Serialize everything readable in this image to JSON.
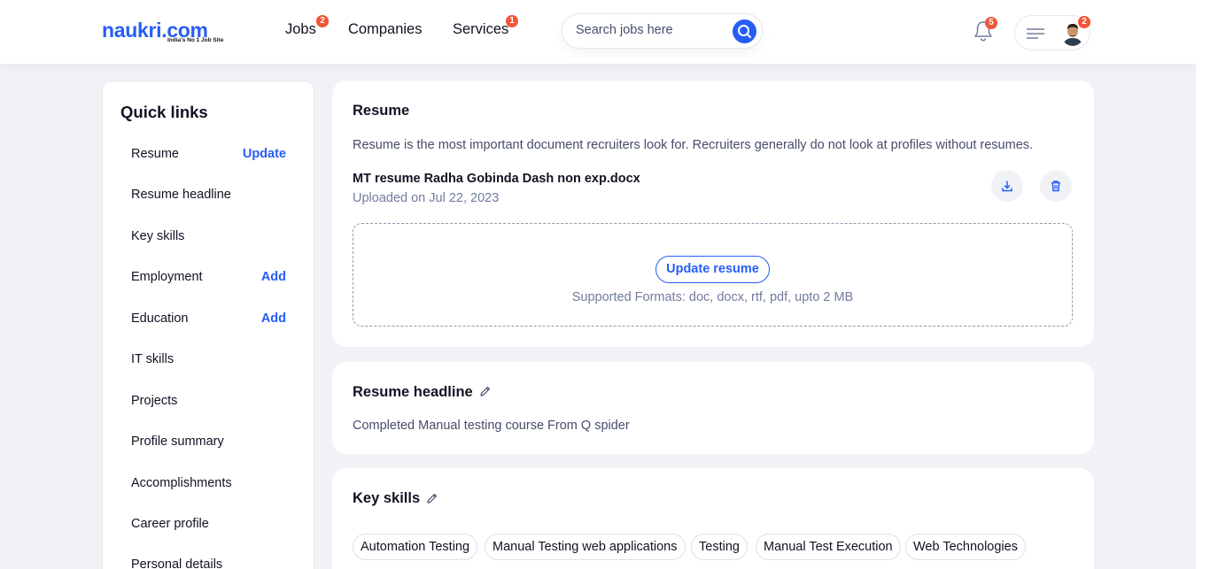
{
  "header": {
    "logo_text": "naukri.com",
    "logo_tagline": "India's No 1 Job Site",
    "nav": [
      {
        "label": "Jobs",
        "badge": "2"
      },
      {
        "label": "Companies",
        "badge": ""
      },
      {
        "label": "Services",
        "badge": "1"
      }
    ],
    "search_placeholder": "Search jobs here",
    "notification_count": "5",
    "profile_badge": "2"
  },
  "quick_links": {
    "title": "Quick links",
    "items": [
      {
        "label": "Resume",
        "action": "Update"
      },
      {
        "label": "Resume headline",
        "action": ""
      },
      {
        "label": "Key skills",
        "action": ""
      },
      {
        "label": "Employment",
        "action": "Add"
      },
      {
        "label": "Education",
        "action": "Add"
      },
      {
        "label": "IT skills",
        "action": ""
      },
      {
        "label": "Projects",
        "action": ""
      },
      {
        "label": "Profile summary",
        "action": ""
      },
      {
        "label": "Accomplishments",
        "action": ""
      },
      {
        "label": "Career profile",
        "action": ""
      },
      {
        "label": "Personal details",
        "action": ""
      }
    ]
  },
  "resume": {
    "title": "Resume",
    "description": "Resume is the most important document recruiters look for. Recruiters generally do not look at profiles without resumes.",
    "file_name": "MT resume Radha Gobinda Dash non exp.docx",
    "uploaded": "Uploaded on Jul 22, 2023",
    "update_button": "Update resume",
    "formats": "Supported Formats: doc, docx, rtf, pdf, upto 2 MB"
  },
  "headline": {
    "title": "Resume headline",
    "text": "Completed Manual testing course From Q spider"
  },
  "key_skills": {
    "title": "Key skills",
    "skills": [
      "Automation Testing",
      "Manual Testing web applications",
      "Testing",
      "Manual Test Execution",
      "Web Technologies"
    ]
  },
  "colors": {
    "accent": "#275df5",
    "badge": "#f05537",
    "background": "#f1f2f5"
  }
}
